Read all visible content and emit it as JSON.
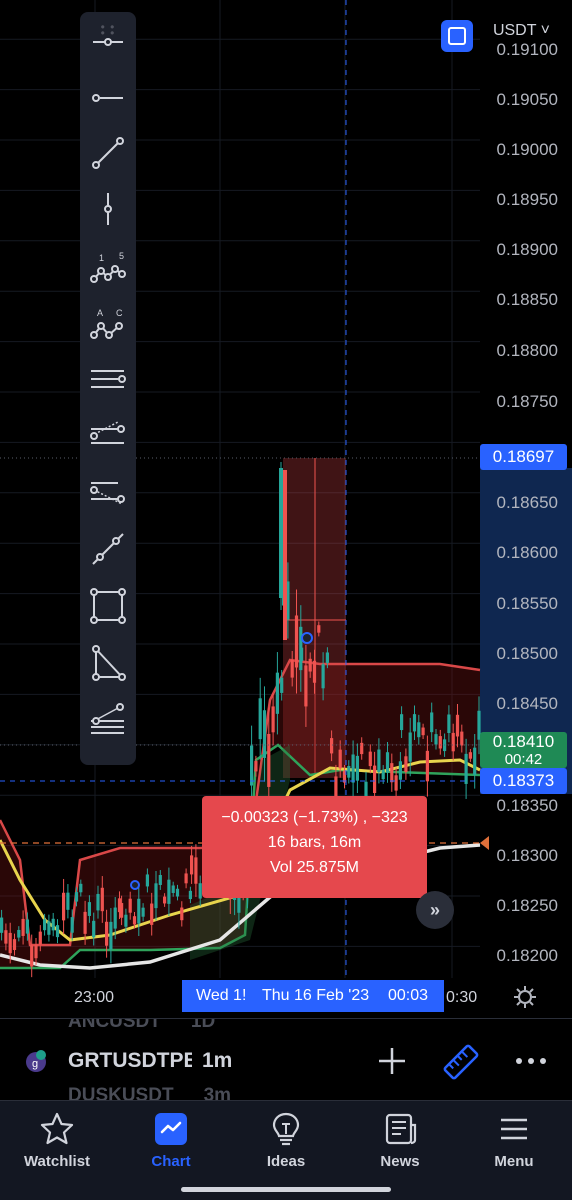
{
  "header": {
    "currency": "USDT ˅",
    "scale_toggle_icon": "auto-scale-icon"
  },
  "price_axis": {
    "labels": [
      "0.19100",
      "0.19050",
      "0.19000",
      "0.18950",
      "0.18900",
      "0.18850",
      "0.18800",
      "0.18750",
      "0.18650",
      "0.18600",
      "0.18550",
      "0.18500",
      "0.18450",
      "0.18350",
      "0.18300",
      "0.18250",
      "0.18200"
    ],
    "high_tag": "0.18697",
    "ma_tag": "0.18410",
    "countdown": "00:42",
    "crosshair_tag": "0.18373"
  },
  "toolbar": {
    "tools": [
      "horizontal-ray-icon",
      "ray-icon",
      "trend-line-icon",
      "vertical-line-icon",
      "xabcd-pattern-icon",
      "abcd-pattern-icon",
      "parallel-lines-icon",
      "pitchfork-icon",
      "gann-fan-icon",
      "extended-line-icon",
      "rectangle-icon",
      "triangle-icon",
      "fib-retracement-icon"
    ],
    "xabcd_labels": [
      "1",
      "5"
    ],
    "abcd_labels": [
      "A",
      "C"
    ]
  },
  "measure": {
    "change": "−0.00323 (−1.73%) , −323",
    "bars": "16 bars, 16m",
    "volume": "Vol 25.875M"
  },
  "time_axis": {
    "label_left": "23:00",
    "label_right": "0:30",
    "crosshair_start": "Wed 1!",
    "crosshair_end": "Thu 16 Feb '23",
    "crosshair_time": "00:03"
  },
  "symbol_bar": {
    "ghost_above": "ANCUSDT",
    "ghost_above_interval": "1D",
    "symbol": "GRTUSDTPERP",
    "interval": "1m",
    "ghost_below": "DUSKUSDT",
    "ghost_below_interval": "3m"
  },
  "nav": {
    "items": [
      {
        "label": "Watchlist",
        "icon": "star-icon"
      },
      {
        "label": "Chart",
        "icon": "chart-icon"
      },
      {
        "label": "Ideas",
        "icon": "lightbulb-icon"
      },
      {
        "label": "News",
        "icon": "news-icon"
      },
      {
        "label": "Menu",
        "icon": "menu-icon"
      }
    ],
    "active": "Chart"
  },
  "colors": {
    "accent": "#2962ff",
    "up": "#26a69a",
    "down": "#ef5350",
    "measure_bg": "#e5484d",
    "ma_yellow": "#e8d44d",
    "ma_white": "#e6e6e6",
    "band_red": "#d94848",
    "band_green": "#2fa35b"
  }
}
